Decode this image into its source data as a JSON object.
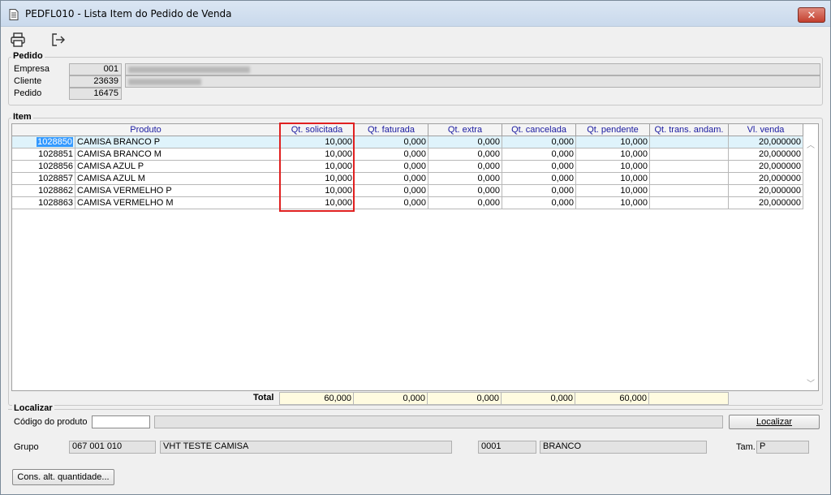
{
  "window": {
    "title": "PEDFL010 - Lista Item do Pedido de Venda",
    "close_label": "✕"
  },
  "toolbar": {
    "print_icon": "printer-icon",
    "exit_icon": "exit-icon"
  },
  "pedido": {
    "title": "Pedido",
    "empresa_label": "Empresa",
    "empresa_code": "001",
    "cliente_label": "Cliente",
    "cliente_code": "23639",
    "pedido_label": "Pedido",
    "pedido_code": "16475"
  },
  "item": {
    "title": "Item",
    "columns": [
      "Produto",
      "Qt. solicitada",
      "Qt. faturada",
      "Qt. extra",
      "Qt. cancelada",
      "Qt. pendente",
      "Qt. trans. andam.",
      "Vl. venda"
    ],
    "rows": [
      {
        "code": "1028850",
        "name": "CAMISA BRANCO P",
        "solicitada": "10,000",
        "faturada": "0,000",
        "extra": "0,000",
        "cancelada": "0,000",
        "pendente": "10,000",
        "trans": "",
        "venda": "20,000000"
      },
      {
        "code": "1028851",
        "name": "CAMISA BRANCO M",
        "solicitada": "10,000",
        "faturada": "0,000",
        "extra": "0,000",
        "cancelada": "0,000",
        "pendente": "10,000",
        "trans": "",
        "venda": "20,000000"
      },
      {
        "code": "1028856",
        "name": "CAMISA AZUL P",
        "solicitada": "10,000",
        "faturada": "0,000",
        "extra": "0,000",
        "cancelada": "0,000",
        "pendente": "10,000",
        "trans": "",
        "venda": "20,000000"
      },
      {
        "code": "1028857",
        "name": "CAMISA AZUL M",
        "solicitada": "10,000",
        "faturada": "0,000",
        "extra": "0,000",
        "cancelada": "0,000",
        "pendente": "10,000",
        "trans": "",
        "venda": "20,000000"
      },
      {
        "code": "1028862",
        "name": "CAMISA VERMELHO P",
        "solicitada": "10,000",
        "faturada": "0,000",
        "extra": "0,000",
        "cancelada": "0,000",
        "pendente": "10,000",
        "trans": "",
        "venda": "20,000000"
      },
      {
        "code": "1028863",
        "name": "CAMISA VERMELHO M",
        "solicitada": "10,000",
        "faturada": "0,000",
        "extra": "0,000",
        "cancelada": "0,000",
        "pendente": "10,000",
        "trans": "",
        "venda": "20,000000"
      }
    ],
    "total_label": "Total",
    "totals": {
      "solicitada": "60,000",
      "faturada": "0,000",
      "extra": "0,000",
      "cancelada": "0,000",
      "pendente": "60,000",
      "trans": ""
    }
  },
  "localizar": {
    "title": "Localizar",
    "codigo_label": "Código do produto",
    "codigo_value": "",
    "button_label": "Localizar"
  },
  "info": {
    "grupo_label": "Grupo",
    "grupo_code": "067 001 010",
    "grupo_desc": "VHT TESTE CAMISA",
    "cor_code": "0001",
    "cor_desc": "BRANCO",
    "tam_label": "Tam.",
    "tam_value": "P"
  },
  "footer": {
    "cons_button_label": "Cons. alt. quantidade..."
  },
  "colors": {
    "highlight": "#e02020",
    "selected_row": "#dff3fb",
    "selected_code": "#3399ff"
  }
}
